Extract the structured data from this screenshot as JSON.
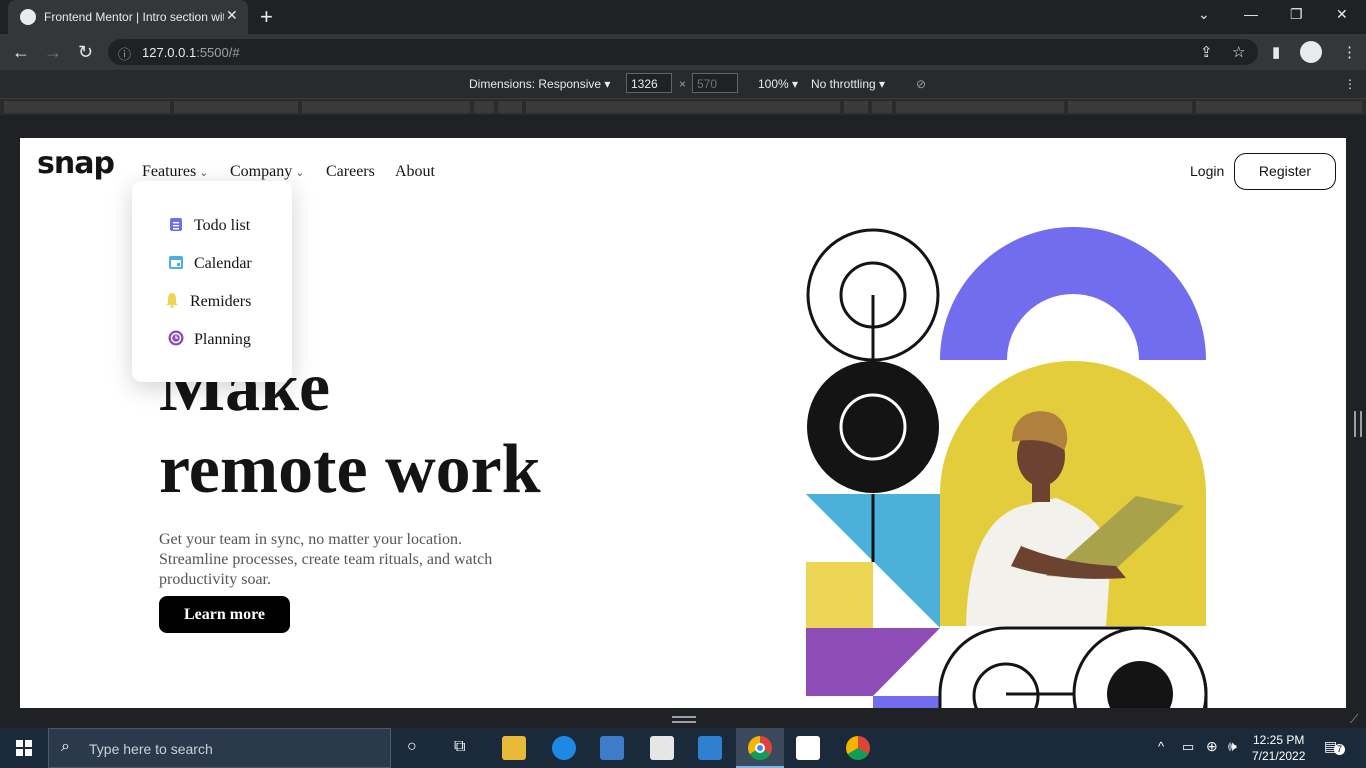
{
  "browser": {
    "tab_title": "Frontend Mentor | Intro section with dropdown navigation",
    "url_host": "127.0.0.1",
    "url_rest": ":5500/#",
    "devtools": {
      "dimensions_label": "Dimensions: Responsive",
      "width": "1326",
      "height": "570",
      "zoom": "100%",
      "throttling": "No throttling"
    }
  },
  "page": {
    "logo": "snap",
    "nav": {
      "features": "Features",
      "company": "Company",
      "careers": "Careers",
      "about": "About",
      "login": "Login",
      "register": "Register"
    },
    "dropdown": [
      {
        "label": "Todo list",
        "icon": "todo-icon",
        "color": "#726cee"
      },
      {
        "label": "Calendar",
        "icon": "calendar-icon",
        "color": "#4bb1da"
      },
      {
        "label": "Remiders",
        "icon": "bell-icon",
        "color": "#edd556"
      },
      {
        "label": "Planning",
        "icon": "planning-icon",
        "color": "#8e4cb6"
      }
    ],
    "hero": {
      "line1": "Make",
      "line2": "remote work",
      "description": "Get your team in sync, no matter your location. Streamline processes, create team rituals, and watch productivity soar.",
      "cta": "Learn more"
    }
  },
  "taskbar": {
    "search_placeholder": "Type here to search",
    "time": "12:25 PM",
    "date": "7/21/2022",
    "notification_count": "7"
  }
}
